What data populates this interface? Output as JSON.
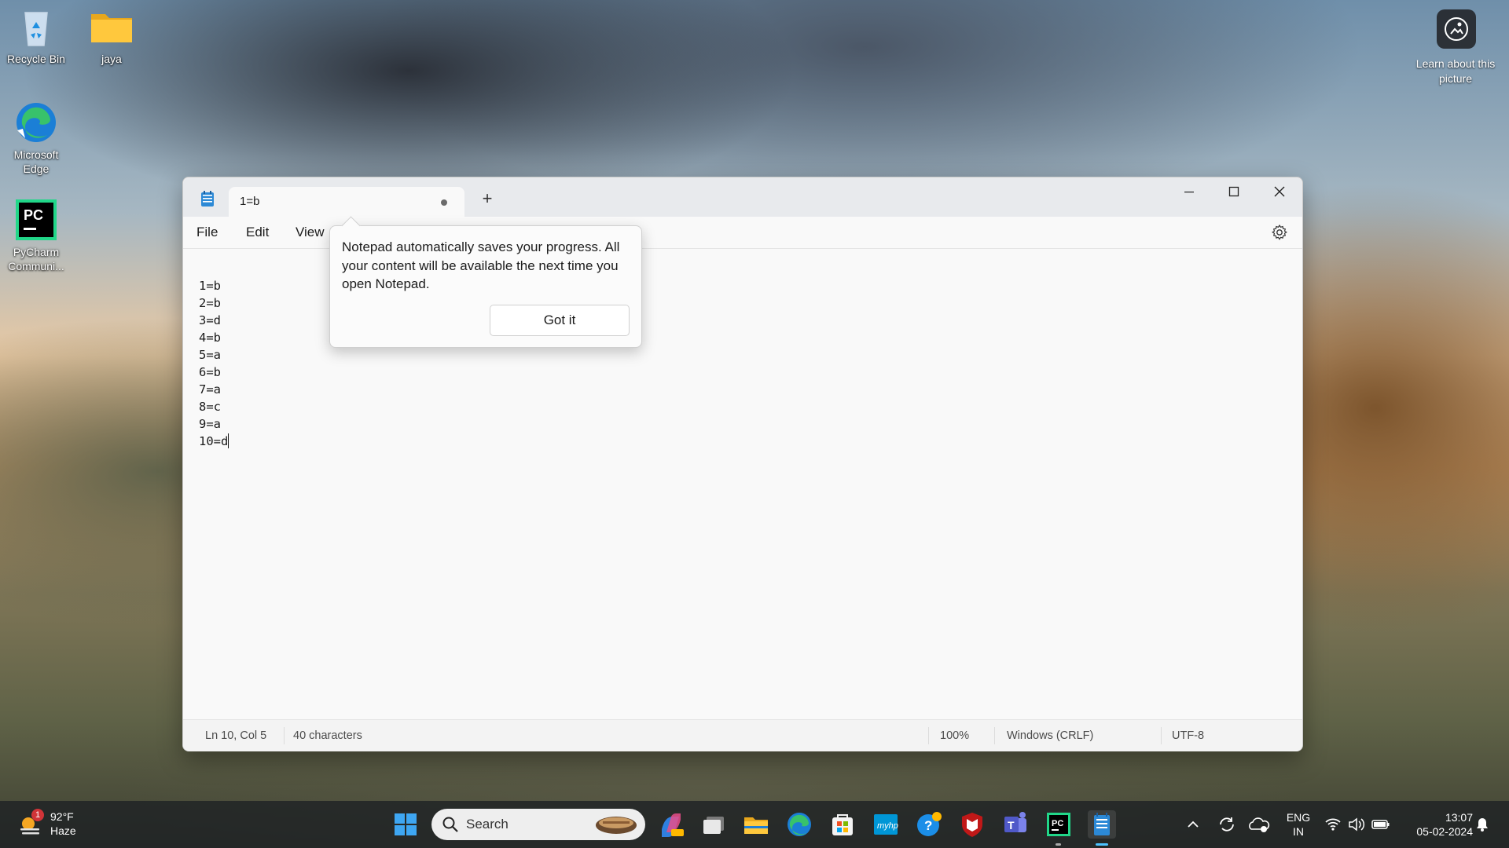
{
  "desktop": {
    "icons": [
      {
        "label": "Recycle Bin",
        "icon": "recycle-bin-icon"
      },
      {
        "label": "jaya",
        "icon": "folder-icon"
      },
      {
        "label": "Microsoft Edge",
        "icon": "edge-icon"
      },
      {
        "label": "PyCharm Communi...",
        "icon": "pycharm-icon"
      }
    ],
    "learn_picture": "Learn about this picture"
  },
  "notepad": {
    "tab_title": "1=b",
    "menu": {
      "file": "File",
      "edit": "Edit",
      "view": "View"
    },
    "lines": [
      "1=b",
      "2=b",
      "3=d",
      "4=b",
      "5=a",
      "6=b",
      "7=a",
      "8=c",
      "9=a",
      "10=d"
    ],
    "status": {
      "position": "Ln 10, Col 5",
      "characters": "40 characters",
      "zoom": "100%",
      "line_ending": "Windows (CRLF)",
      "encoding": "UTF-8"
    },
    "popup": {
      "message": "Notepad automatically saves your progress. All your content will be available the next time you open Notepad.",
      "button": "Got it"
    }
  },
  "taskbar": {
    "weather": {
      "temp": "92°F",
      "condition": "Haze",
      "badge": "1"
    },
    "search_placeholder": "Search",
    "tray": {
      "lang1": "ENG",
      "lang2": "IN",
      "time": "13:07",
      "date": "05-02-2024"
    }
  },
  "colors": {
    "accent": "#0067c0",
    "window_bg": "#f9f9f9",
    "titlebar": "#e8eaed"
  }
}
